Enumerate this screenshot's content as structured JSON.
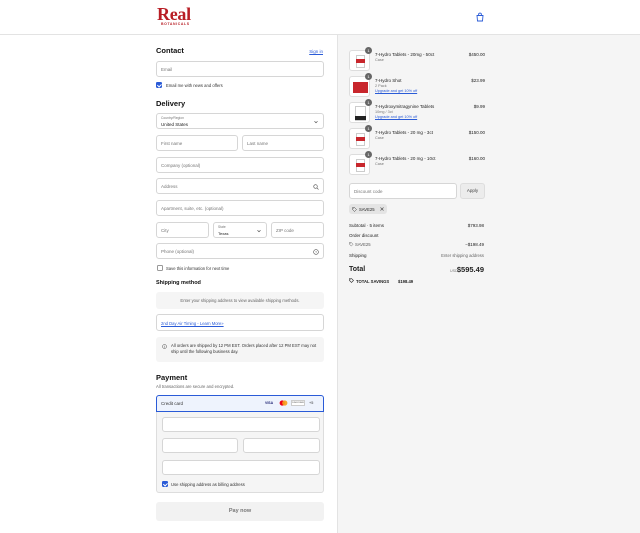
{
  "header": {
    "logo": "Real",
    "logo_sub": "BOTANICALS"
  },
  "contact": {
    "heading": "Contact",
    "sign_in": "Sign in",
    "email_placeholder": "Email",
    "news_label": "Email me with news and offers"
  },
  "delivery": {
    "heading": "Delivery",
    "country_label": "Country/Region",
    "country_value": "United States",
    "first_name": "First name",
    "last_name": "Last name",
    "company": "Company (optional)",
    "address": "Address",
    "apartment": "Apartment, suite, etc. (optional)",
    "city": "City",
    "state_label": "State",
    "state_value": "Texas",
    "zip": "ZIP code",
    "phone": "Phone (optional)",
    "save_label": "Save this information for next time"
  },
  "shipping": {
    "heading": "Shipping method",
    "notice": "Enter your shipping address to view available shipping methods.",
    "air_link": "2nd Day Air Timing - Learn More»",
    "info": "All orders are shipped by 12 PM EST. Orders placed after 12 PM EST may not ship until the following business day."
  },
  "payment": {
    "heading": "Payment",
    "subtitle": "All transactions are secure and encrypted.",
    "method": "Credit card",
    "cards": [
      "VISA",
      "DISCOVER",
      "+5"
    ],
    "billing_label": "Use shipping address as billing address",
    "pay_button": "Pay now"
  },
  "cart": {
    "items": [
      {
        "qty": "1",
        "name": "7-Hydro Tablets - 20mg - 50ct",
        "variant": "Case",
        "upgrade": "",
        "price": "$450.00"
      },
      {
        "qty": "1",
        "name": "7-Hydro Shot",
        "variant": "2 Pack",
        "upgrade": "Upgrade and get 10% off",
        "price": "$23.99"
      },
      {
        "qty": "1",
        "name": "7-Hydroxymitragynine Tablets",
        "variant": "10mg / 3ct",
        "upgrade": "Upgrade and get 10% off",
        "price": "$9.99"
      },
      {
        "qty": "1",
        "name": "7-Hydro Tablets - 20 mg - 3ct",
        "variant": "Case",
        "upgrade": "",
        "price": "$150.00"
      },
      {
        "qty": "1",
        "name": "7-Hydro Tablets - 20 mg - 10ct",
        "variant": "Case",
        "upgrade": "",
        "price": "$160.00"
      }
    ],
    "discount_placeholder": "Discount code",
    "apply": "Apply",
    "code": "SAVE25",
    "subtotal_label": "Subtotal · 5 items",
    "subtotal_value": "$793.98",
    "order_discount_label": "Order discount",
    "order_discount_code": "SAVE25",
    "order_discount_value": "−$198.49",
    "shipping_label": "Shipping",
    "shipping_value": "Enter shipping address",
    "total_label": "Total",
    "currency": "USD",
    "total_value": "$595.49",
    "savings_label": "TOTAL SAVINGS",
    "savings_value": "$198.49"
  },
  "colors": {
    "accent": "#2a5bd7",
    "brand": "#b81e25"
  }
}
